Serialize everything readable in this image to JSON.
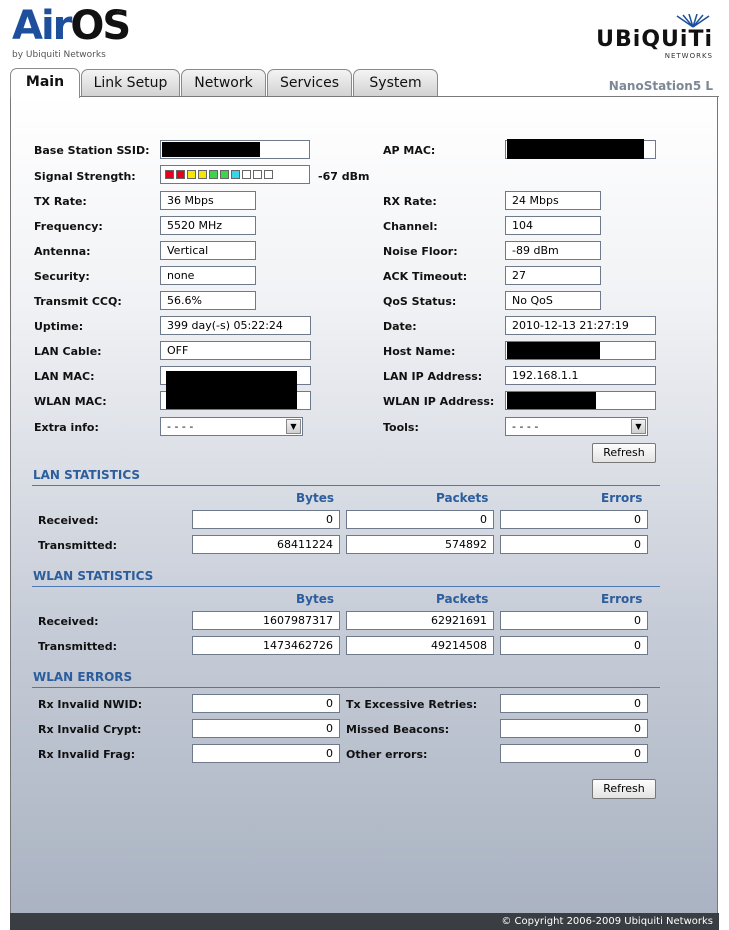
{
  "brand": {
    "air": "Air",
    "os": "OS",
    "tm": "™",
    "by": "by Ubiquiti Networks",
    "ubnt": "UBiQUiTi",
    "ubnt_sub": "NETWORKS"
  },
  "device_name": "NanoStation5 L",
  "tabs": [
    {
      "label": "Main"
    },
    {
      "label": "Link Setup"
    },
    {
      "label": "Network"
    },
    {
      "label": "Services"
    },
    {
      "label": "System"
    }
  ],
  "status": {
    "ssid_label": "Base Station SSID:",
    "ap_mac_label": "AP MAC:",
    "signal_label": "Signal Strength:",
    "signal_value": "-67 dBm",
    "signal_level_fraction": 0.7,
    "signal_colors": [
      "#e8001c",
      "#e8001c",
      "#f7e600",
      "#f7e600",
      "#3fd34b",
      "#3fd34b",
      "#3ad6e8",
      "#ffffff",
      "#ffffff",
      "#ffffff"
    ],
    "tx_rate_label": "TX Rate:",
    "tx_rate": "36 Mbps",
    "rx_rate_label": "RX Rate:",
    "rx_rate": "24 Mbps",
    "frequency_label": "Frequency:",
    "frequency": "5520 MHz",
    "channel_label": "Channel:",
    "channel": "104",
    "antenna_label": "Antenna:",
    "antenna": "Vertical",
    "noise_label": "Noise Floor:",
    "noise": "-89 dBm",
    "security_label": "Security:",
    "security": "none",
    "ack_label": "ACK Timeout:",
    "ack": "27",
    "ccq_label": "Transmit CCQ:",
    "ccq": "56.6%",
    "qos_label": "QoS Status:",
    "qos": "No QoS",
    "uptime_label": "Uptime:",
    "uptime": "399 day(-s) 05:22:24",
    "date_label": "Date:",
    "date": "2010-12-13 21:27:19",
    "lan_cable_label": "LAN Cable:",
    "lan_cable": "OFF",
    "host_label": "Host Name:",
    "lan_mac_label": "LAN MAC:",
    "lan_ip_label": "LAN IP Address:",
    "lan_ip": "192.168.1.1",
    "wlan_mac_label": "WLAN MAC:",
    "wlan_ip_label": "WLAN IP Address:",
    "extra_label": "Extra info:",
    "extra_value": "- - - -",
    "tools_label": "Tools:",
    "tools_value": "- - - -",
    "refresh": "Refresh"
  },
  "headers": {
    "bytes": "Bytes",
    "packets": "Packets",
    "errors": "Errors"
  },
  "lan_stats": {
    "title": "LAN STATISTICS",
    "received_label": "Received:",
    "received": [
      "0",
      "0",
      "0"
    ],
    "transmitted_label": "Transmitted:",
    "transmitted": [
      "68411224",
      "574892",
      "0"
    ]
  },
  "wlan_stats": {
    "title": "WLAN STATISTICS",
    "received_label": "Received:",
    "received": [
      "1607987317",
      "62921691",
      "0"
    ],
    "transmitted_label": "Transmitted:",
    "transmitted": [
      "1473462726",
      "49214508",
      "0"
    ]
  },
  "wlan_errors": {
    "title": "WLAN ERRORS",
    "nwid_label": "Rx Invalid NWID:",
    "nwid": "0",
    "retries_label": "Tx Excessive Retries:",
    "retries": "0",
    "crypt_label": "Rx Invalid Crypt:",
    "crypt": "0",
    "beacons_label": "Missed Beacons:",
    "beacons": "0",
    "frag_label": "Rx Invalid Frag:",
    "frag": "0",
    "other_label": "Other errors:",
    "other": "0",
    "refresh": "Refresh"
  },
  "footer": "© Copyright 2006-2009 Ubiquiti Networks"
}
